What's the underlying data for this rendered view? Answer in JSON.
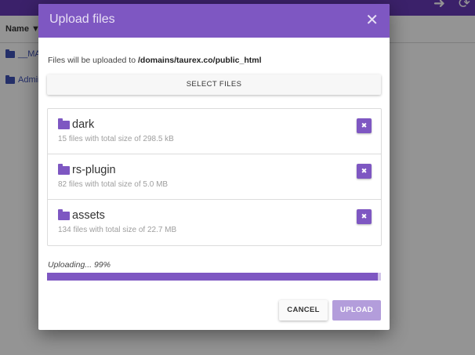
{
  "background": {
    "name_column": "Name ▼",
    "rows": [
      "__MAC",
      "Admin"
    ]
  },
  "modal": {
    "title": "Upload files",
    "close_symbol": "✕",
    "destination_prefix": "Files will be uploaded to ",
    "destination_path": "/domains/taurex.co/public_html",
    "select_files_label": "SELECT FILES",
    "files": [
      {
        "name": "dark",
        "meta": "15 files with total size of 298.5 kB",
        "remove_symbol": "✖"
      },
      {
        "name": "rs-plugin",
        "meta": "82 files with total size of 5.0 MB",
        "remove_symbol": "✖"
      },
      {
        "name": "assets",
        "meta": "134 files with total size of 22.7 MB",
        "remove_symbol": "✖"
      }
    ],
    "progress_text": "Uploading... 99%",
    "progress_value": 0.99,
    "cancel_label": "CANCEL",
    "upload_label": "UPLOAD"
  },
  "colors": {
    "accent": "#7e57c2",
    "accent_disabled": "#b39ddb",
    "topbar": "#673ab7"
  }
}
